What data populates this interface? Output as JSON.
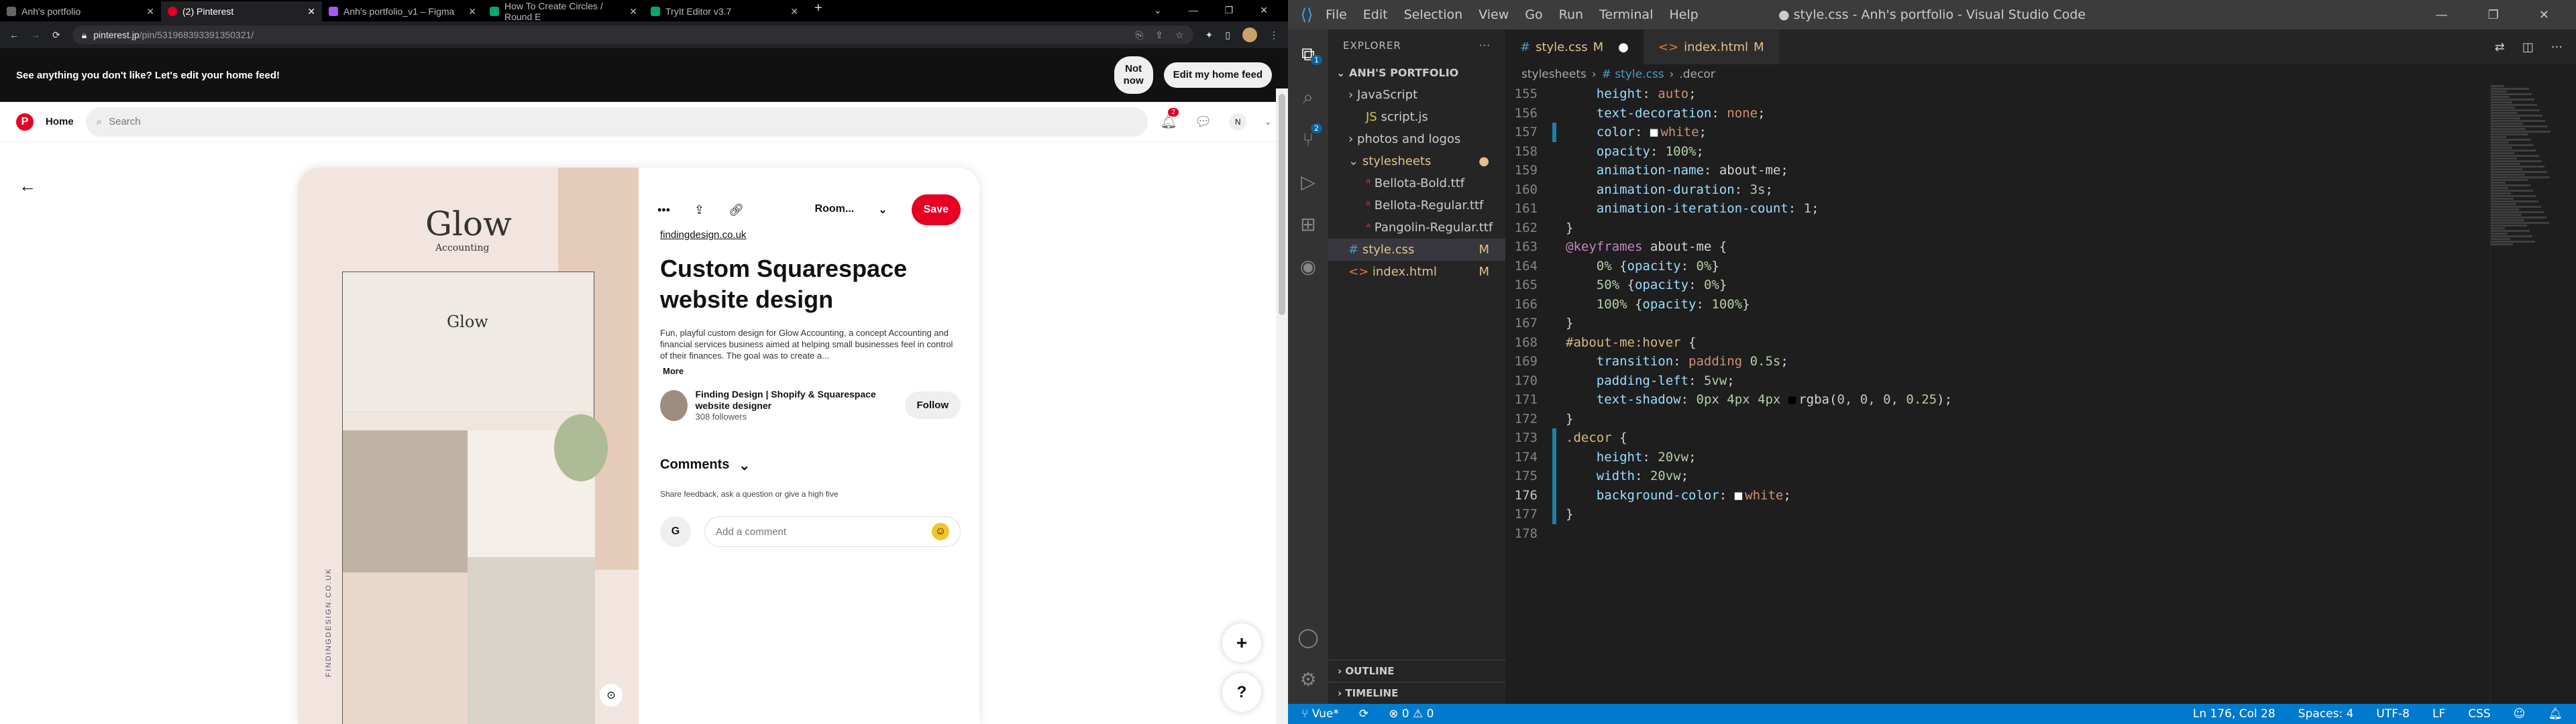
{
  "browser": {
    "tabs": [
      {
        "title": "Anh's portfolio",
        "active": false
      },
      {
        "title": "(2) Pinterest",
        "active": true
      },
      {
        "title": "Anh's portfolio_v1 – Figma",
        "active": false
      },
      {
        "title": "How To Create Circles / Round E",
        "active": false
      },
      {
        "title": "TryIt Editor v3.7",
        "active": false
      }
    ],
    "new_tab": "+",
    "window_controls": [
      "⌄",
      "—",
      "❐",
      "✕"
    ],
    "url_host": "pinterest.jp",
    "url_path": "/pin/531968393391350321/"
  },
  "banner": {
    "message": "See anything you don't like? Let's edit your home feed!",
    "not_now_line1": "Not",
    "not_now_line2": "now",
    "edit_button": "Edit my home feed"
  },
  "pinterest_header": {
    "logo": "P",
    "home": "Home",
    "search_placeholder": "Search",
    "notifications_count": "2",
    "profile_initial": "N"
  },
  "pin": {
    "image": {
      "brand": "Glow",
      "brand_sub": "Accounting",
      "mock_brand": "Glow",
      "side_caption": "FINDINGDESIGN.CO.UK"
    },
    "board": "Room...",
    "save": "Save",
    "source": "findingdesign.co.uk",
    "title": "Custom Squarespace website design",
    "description": "Fun, playful custom design for Glow Accounting, a concept Accounting and financial services business aimed at helping small businesses feel in control of their finances. The goal was to create a...",
    "more": "More",
    "author_name": "Finding Design | Shopify & Squarespace website designer",
    "author_followers": "308 followers",
    "follow": "Follow",
    "comments_heading": "Comments",
    "feedback_prompt": "Share feedback, ask a question or give a high five",
    "user_initial": "G",
    "comment_placeholder": "Add a comment"
  },
  "fabs": {
    "plus": "+",
    "help": "?"
  },
  "vscode": {
    "menu": [
      "File",
      "Edit",
      "Selection",
      "View",
      "Go",
      "Run",
      "Terminal",
      "Help"
    ],
    "window_title": "● style.css - Anh's portfolio - Visual Studio Code",
    "explorer_title": "EXPLORER",
    "project": "ANH'S PORTFOLIO",
    "tree": [
      {
        "label": "JavaScript",
        "type": "folder",
        "indent": 1,
        "arrow": "›"
      },
      {
        "label": "script.js",
        "type": "js",
        "indent": 2
      },
      {
        "label": "photos and logos",
        "type": "folder",
        "indent": 1,
        "arrow": "›"
      },
      {
        "label": "stylesheets",
        "type": "folder-mod",
        "indent": 1,
        "arrow": "⌄"
      },
      {
        "label": "Bellota-Bold.ttf",
        "type": "ttf",
        "indent": 2
      },
      {
        "label": "Bellota-Regular.ttf",
        "type": "ttf",
        "indent": 2
      },
      {
        "label": "Pangolin-Regular.ttf",
        "type": "ttf",
        "indent": 2
      },
      {
        "label": "style.css",
        "type": "css",
        "indent": 2,
        "mark": "M",
        "selected": true
      },
      {
        "label": "index.html",
        "type": "html",
        "indent": 1,
        "mark": "M"
      }
    ],
    "outline": "OUTLINE",
    "timeline": "TIMELINE",
    "editor_tabs": [
      {
        "icon": "#",
        "label": "style.css",
        "mark": "M",
        "dirty": "●",
        "active": true
      },
      {
        "icon": "<>",
        "label": "index.html",
        "mark": "M",
        "dirty": "",
        "active": false
      }
    ],
    "breadcrumb": [
      "stylesheets",
      "# style.css",
      ".decor"
    ],
    "code": [
      {
        "n": 155,
        "mod": false,
        "t": [
          [
            "    ",
            ""
          ],
          [
            "height",
            "p"
          ],
          [
            ": ",
            "w"
          ],
          [
            "auto",
            "v"
          ],
          [
            ";",
            "w"
          ]
        ]
      },
      {
        "n": 156,
        "mod": false,
        "t": [
          [
            "    ",
            ""
          ],
          [
            "text-decoration",
            "p"
          ],
          [
            ": ",
            "w"
          ],
          [
            "none",
            "v"
          ],
          [
            ";",
            "w"
          ]
        ]
      },
      {
        "n": 157,
        "mod": true,
        "t": [
          [
            "    ",
            ""
          ],
          [
            "color",
            "p"
          ],
          [
            ": ",
            "w"
          ],
          [
            "■",
            "sw"
          ],
          [
            "white",
            "v"
          ],
          [
            ";",
            "w"
          ]
        ]
      },
      {
        "n": 158,
        "mod": false,
        "t": [
          [
            "    ",
            ""
          ],
          [
            "opacity",
            "p"
          ],
          [
            ": ",
            "w"
          ],
          [
            "100%",
            "n"
          ],
          [
            ";",
            "w"
          ]
        ]
      },
      {
        "n": 159,
        "mod": false,
        "t": [
          [
            "    ",
            ""
          ],
          [
            "animation-name",
            "p"
          ],
          [
            ": ",
            "w"
          ],
          [
            "about-me",
            "w"
          ],
          [
            ";",
            "w"
          ]
        ]
      },
      {
        "n": 160,
        "mod": false,
        "t": [
          [
            "    ",
            ""
          ],
          [
            "animation-duration",
            "p"
          ],
          [
            ": ",
            "w"
          ],
          [
            "3s",
            "n"
          ],
          [
            ";",
            "w"
          ]
        ]
      },
      {
        "n": 161,
        "mod": false,
        "t": [
          [
            "    ",
            ""
          ],
          [
            "animation-iteration-count",
            "p"
          ],
          [
            ": ",
            "w"
          ],
          [
            "1",
            "n"
          ],
          [
            ";",
            "w"
          ]
        ]
      },
      {
        "n": 162,
        "mod": false,
        "t": [
          [
            "}",
            "w"
          ]
        ]
      },
      {
        "n": 163,
        "mod": false,
        "t": [
          [
            "@keyframes",
            "k"
          ],
          [
            " about-me ",
            "w"
          ],
          [
            "{",
            "w"
          ]
        ]
      },
      {
        "n": 164,
        "mod": false,
        "t": [
          [
            "    ",
            ""
          ],
          [
            "0%",
            "n"
          ],
          [
            " {",
            "w"
          ],
          [
            "opacity",
            "p"
          ],
          [
            ": ",
            "w"
          ],
          [
            "0%",
            "n"
          ],
          [
            "}",
            "w"
          ]
        ]
      },
      {
        "n": 165,
        "mod": false,
        "t": [
          [
            "    ",
            ""
          ],
          [
            "50%",
            "n"
          ],
          [
            " {",
            "w"
          ],
          [
            "opacity",
            "p"
          ],
          [
            ": ",
            "w"
          ],
          [
            "0%",
            "n"
          ],
          [
            "}",
            "w"
          ]
        ]
      },
      {
        "n": 166,
        "mod": false,
        "t": [
          [
            "    ",
            ""
          ],
          [
            "100%",
            "n"
          ],
          [
            " {",
            "w"
          ],
          [
            "opacity",
            "p"
          ],
          [
            ": ",
            "w"
          ],
          [
            "100%",
            "n"
          ],
          [
            "}",
            "w"
          ]
        ]
      },
      {
        "n": 167,
        "mod": false,
        "t": [
          [
            "}",
            "w"
          ]
        ]
      },
      {
        "n": 168,
        "mod": false,
        "t": [
          [
            "#about-me:hover",
            "s"
          ],
          [
            " {",
            "w"
          ]
        ]
      },
      {
        "n": 169,
        "mod": false,
        "t": [
          [
            "    ",
            ""
          ],
          [
            "transition",
            "p"
          ],
          [
            ": ",
            "w"
          ],
          [
            "padding ",
            "v"
          ],
          [
            "0.5s",
            "n"
          ],
          [
            ";",
            "w"
          ]
        ]
      },
      {
        "n": 170,
        "mod": false,
        "t": [
          [
            "    ",
            ""
          ],
          [
            "padding-left",
            "p"
          ],
          [
            ": ",
            "w"
          ],
          [
            "5vw",
            "n"
          ],
          [
            ";",
            "w"
          ]
        ]
      },
      {
        "n": 171,
        "mod": false,
        "t": [
          [
            "    ",
            ""
          ],
          [
            "text-shadow",
            "p"
          ],
          [
            ": ",
            "w"
          ],
          [
            "0px 4px 4px ",
            "n"
          ],
          [
            "■",
            "swb"
          ],
          [
            "rgba(",
            "w"
          ],
          [
            "0, 0, 0, 0.25",
            "n"
          ],
          [
            ");",
            "w"
          ]
        ]
      },
      {
        "n": 172,
        "mod": false,
        "t": [
          [
            "}",
            "w"
          ]
        ]
      },
      {
        "n": 173,
        "mod": true,
        "t": [
          [
            ".decor",
            "s"
          ],
          [
            " {",
            "w"
          ]
        ]
      },
      {
        "n": 174,
        "mod": true,
        "t": [
          [
            "    ",
            ""
          ],
          [
            "height",
            "p"
          ],
          [
            ": ",
            "w"
          ],
          [
            "20vw",
            "n"
          ],
          [
            ";",
            "w"
          ]
        ]
      },
      {
        "n": 175,
        "mod": true,
        "t": [
          [
            "    ",
            ""
          ],
          [
            "width",
            "p"
          ],
          [
            ": ",
            "w"
          ],
          [
            "20vw",
            "n"
          ],
          [
            ";",
            "w"
          ]
        ]
      },
      {
        "n": 176,
        "mod": true,
        "t": [
          [
            "    ",
            ""
          ],
          [
            "background-color",
            "p"
          ],
          [
            ": ",
            "w"
          ],
          [
            "■",
            "sw"
          ],
          [
            "white",
            "v"
          ],
          [
            ";",
            "w"
          ]
        ]
      },
      {
        "n": 177,
        "mod": true,
        "t": [
          [
            "}",
            "w"
          ]
        ]
      },
      {
        "n": 178,
        "mod": false,
        "t": []
      }
    ],
    "current_line": 176,
    "status": {
      "branch": "Vue*",
      "sync": "⟳",
      "problems": "⊗ 0 ⚠ 0",
      "position": "Ln 176, Col 28",
      "spaces": "Spaces: 4",
      "encoding": "UTF-8",
      "eol": "LF",
      "language": "CSS"
    },
    "colors": {
      "accent": "#007acc",
      "property": "#9cdcfe",
      "value": "#ce9178",
      "number": "#b5cea8",
      "selector": "#d7ba7d",
      "keyword": "#c586c0"
    }
  }
}
